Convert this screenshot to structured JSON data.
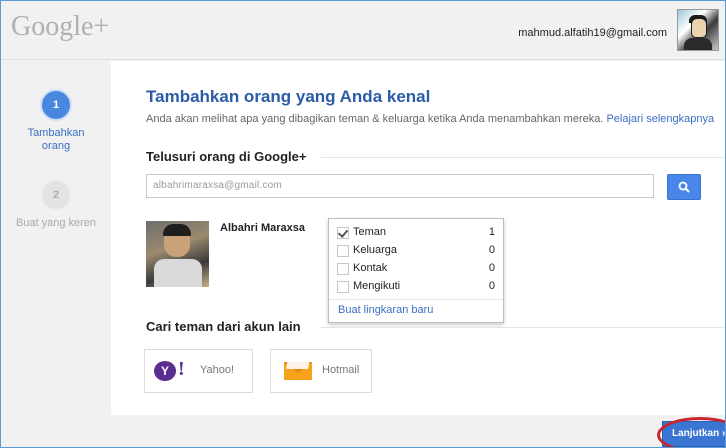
{
  "header": {
    "logo": "Google+",
    "email": "mahmud.alfatih19@gmail.com"
  },
  "steps": [
    {
      "number": "1",
      "label": "Tambahkan orang",
      "state": "active"
    },
    {
      "number": "2",
      "label": "Buat yang keren",
      "state": "inactive"
    }
  ],
  "main": {
    "title": "Tambahkan orang yang Anda kenal",
    "subtitle": "Anda akan melihat apa yang dibagikan teman & keluarga ketika Anda menambahkan mereka.",
    "learn_more": "Pelajari selengkapnya"
  },
  "search": {
    "heading": "Telusuri orang di Google+",
    "value": "albahrimaraxsa@gmail.com",
    "button_icon": "search-icon"
  },
  "person": {
    "name": "Albahri Maraxsa"
  },
  "circles": {
    "items": [
      {
        "label": "Teman",
        "count": "1",
        "checked": true
      },
      {
        "label": "Keluarga",
        "count": "0",
        "checked": false
      },
      {
        "label": "Kontak",
        "count": "0",
        "checked": false
      },
      {
        "label": "Mengikuti",
        "count": "0",
        "checked": false
      }
    ],
    "new_circle": "Buat lingkaran baru"
  },
  "other_accounts": {
    "heading": "Cari teman dari akun lain",
    "yahoo": "Yahoo!",
    "yahoo_logo_letter": "Y",
    "hotmail": "Hotmail"
  },
  "footer": {
    "continue": "Lanjutkan »"
  },
  "colors": {
    "accent": "#3b6fc4",
    "button": "#4a86e8",
    "highlight_ring": "#c7242b"
  }
}
